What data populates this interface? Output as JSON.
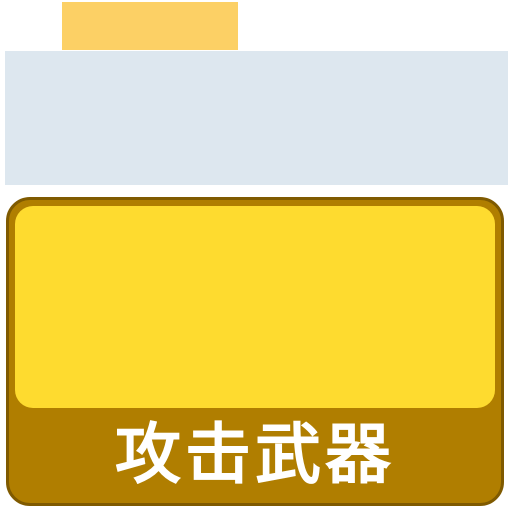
{
  "card": {
    "label": "攻击武器"
  },
  "colors": {
    "tab": "#fcd065",
    "panel": "#dde7ef",
    "card_face": "#fedb2f",
    "card_base": "#b07e00",
    "card_border": "#7f5a00",
    "label_text": "#ffffff"
  }
}
